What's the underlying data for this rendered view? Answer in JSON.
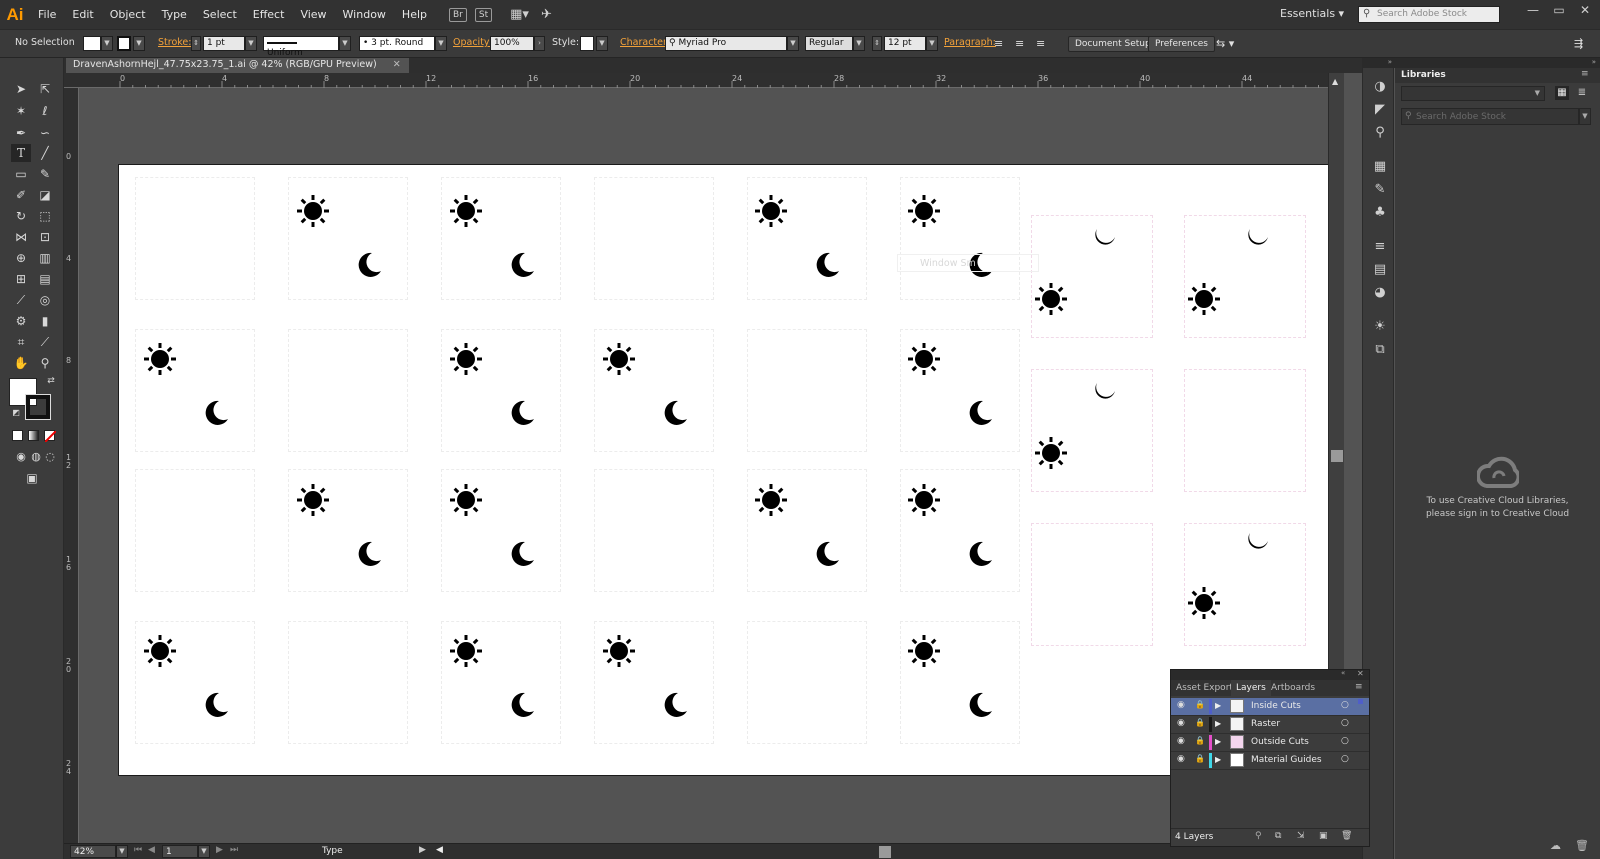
{
  "app": {
    "logo": "Ai",
    "menus": [
      "File",
      "Edit",
      "Object",
      "Type",
      "Select",
      "Effect",
      "View",
      "Window",
      "Help"
    ],
    "bridge_badge": "Br",
    "stock_badge": "St",
    "workspace": "Essentials",
    "stock_search_placeholder": "Search Adobe Stock"
  },
  "control_bar": {
    "selection": "No Selection",
    "stroke_label": "Stroke:",
    "stroke_weight": "1 pt",
    "profile": "Uniform",
    "brush": "3 pt. Round",
    "opacity_label": "Opacity:",
    "opacity": "100%",
    "style_label": "Style:",
    "character_label": "Character:",
    "font": "Myriad Pro",
    "font_style": "Regular",
    "font_size": "12 pt",
    "paragraph_label": "Paragraph:",
    "document_setup": "Document Setup",
    "preferences": "Preferences"
  },
  "document": {
    "tab_title": "DravenAshornHejl_47.75x23.75_1.ai @ 42% (RGB/GPU Preview)",
    "ghost_label": "Window Sm"
  },
  "rulers": {
    "h_numbers": [
      "0",
      "4",
      "8",
      "12",
      "16",
      "20",
      "24",
      "28",
      "32",
      "36",
      "40",
      "44"
    ],
    "v_numbers": [
      "0",
      "4",
      "8",
      "12",
      "16",
      "20",
      "24"
    ]
  },
  "status": {
    "zoom": "42%",
    "artboard_num": "1",
    "tool_name": "Type"
  },
  "libraries": {
    "title": "Libraries",
    "search_placeholder": "Search Adobe Stock",
    "signin_line1": "To use Creative Cloud Libraries,",
    "signin_line2": "please sign in to Creative Cloud"
  },
  "layers_panel": {
    "tabs": [
      "Asset Export",
      "Layers",
      "Artboards"
    ],
    "active_tab": "Layers",
    "layers": [
      {
        "name": "Inside Cuts",
        "color": "#4f5ec9"
      },
      {
        "name": "Raster",
        "color": "#1a1a1a"
      },
      {
        "name": "Outside Cuts",
        "color": "#e54fc9"
      },
      {
        "name": "Material Guides",
        "color": "#3fd7e8"
      }
    ],
    "count": "4 Layers"
  },
  "colors": {
    "accent_orange": "#f3a23a",
    "app_logo": "#ff9a00",
    "active_layer": "#5a6fa3"
  }
}
